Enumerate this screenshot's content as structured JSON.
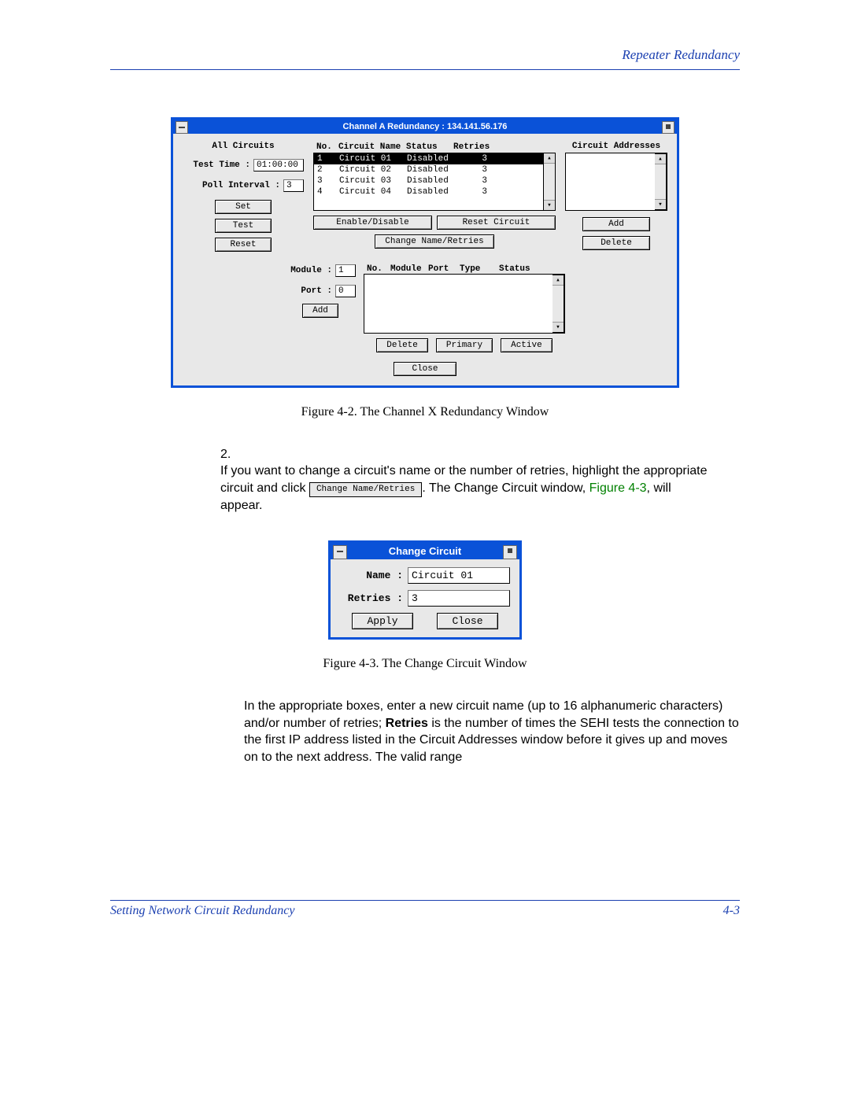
{
  "header": {
    "right": "Repeater Redundancy"
  },
  "fig1": {
    "title": "Channel A Redundancy : 134.141.56.176",
    "left": {
      "all_circuits": "All Circuits",
      "test_time_label": "Test Time :",
      "test_time_value": "01:00:00",
      "poll_interval_label": "Poll Interval :",
      "poll_interval_value": "3",
      "btn_set": "Set",
      "btn_test": "Test",
      "btn_reset": "Reset"
    },
    "list": {
      "headers": {
        "no": "No.",
        "name": "Circuit Name",
        "status": "Status",
        "retries": "Retries"
      },
      "rows": [
        {
          "no": "1",
          "name": "Circuit 01",
          "status": "Disabled",
          "retries": "3",
          "selected": true
        },
        {
          "no": "2",
          "name": "Circuit 02",
          "status": "Disabled",
          "retries": "3"
        },
        {
          "no": "3",
          "name": "Circuit 03",
          "status": "Disabled",
          "retries": "3"
        },
        {
          "no": "4",
          "name": "Circuit 04",
          "status": "Disabled",
          "retries": "3"
        }
      ],
      "btn_enable": "Enable/Disable",
      "btn_reset_circuit": "Reset Circuit",
      "btn_change": "Change Name/Retries"
    },
    "addresses": {
      "header": "Circuit Addresses",
      "btn_add": "Add",
      "btn_delete": "Delete"
    },
    "module": {
      "module_label": "Module :",
      "module_value": "1",
      "port_label": "Port :",
      "port_value": "0",
      "btn_add": "Add"
    },
    "portlist": {
      "headers": {
        "no": "No.",
        "module": "Module",
        "port": "Port",
        "type": "Type",
        "status": "Status"
      },
      "btn_delete": "Delete",
      "btn_primary": "Primary",
      "btn_active": "Active"
    },
    "btn_close": "Close",
    "caption": "Figure 4-2. The Channel X Redundancy Window"
  },
  "step2": {
    "num": "2.",
    "text_a": "If you want to change a circuit's name or the number of retries, highlight the appropriate circuit and click",
    "btn": "Change Name/Retries",
    "text_b": ". The Change Circuit window, ",
    "figref": "Figure 4-3",
    "text_c": ", will appear."
  },
  "fig2": {
    "title": "Change Circuit",
    "name_label": "Name :",
    "name_value": "Circuit 01",
    "retries_label": "Retries :",
    "retries_value": "3",
    "btn_apply": "Apply",
    "btn_close": "Close",
    "caption": "Figure 4-3. The Change Circuit Window"
  },
  "para3": {
    "a": "In the appropriate boxes, enter a new circuit name (up to 16 alphanumeric characters) and/or number of retries; ",
    "b": "Retries",
    "c": " is the number of times the SEHI tests the connection to the first IP address listed in the Circuit Addresses window before it gives up and moves on to the next address. The valid range"
  },
  "footer": {
    "left": "Setting Network Circuit Redundancy",
    "right": "4-3"
  }
}
